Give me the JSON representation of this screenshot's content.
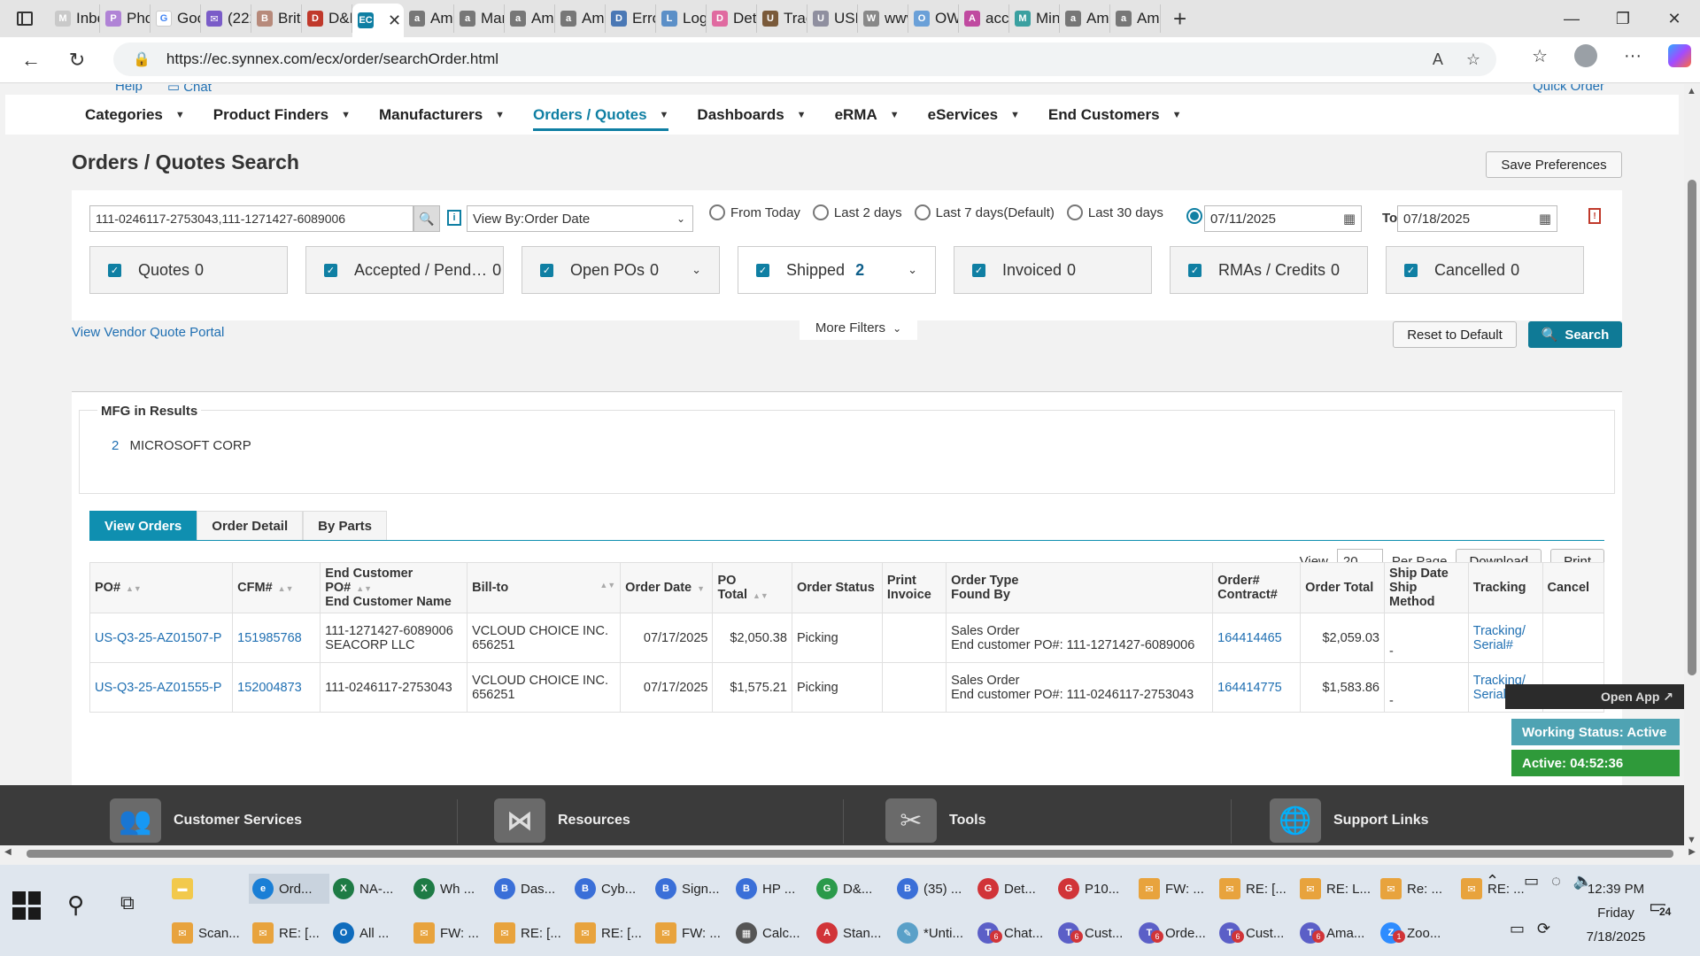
{
  "browser": {
    "tabs": [
      {
        "label": "Inbo",
        "color": "#c9c9c9",
        "glyph": "M"
      },
      {
        "label": "Phot",
        "color": "#b083d6",
        "glyph": "P"
      },
      {
        "label": "Goo",
        "color": "#ffffff",
        "glyph": "G"
      },
      {
        "label": "(222",
        "color": "#7a5cc8",
        "glyph": "✉"
      },
      {
        "label": "Briti",
        "color": "#b78a7b",
        "glyph": "B"
      },
      {
        "label": "D&H",
        "color": "#c0392b",
        "glyph": "D"
      },
      {
        "label": "",
        "color": "#0f7fa3",
        "glyph": "EC",
        "active": true
      },
      {
        "label": "Ama",
        "color": "#777777",
        "glyph": "a"
      },
      {
        "label": "Man",
        "color": "#777777",
        "glyph": "a"
      },
      {
        "label": "Ama",
        "color": "#777777",
        "glyph": "a"
      },
      {
        "label": "Ama",
        "color": "#777777",
        "glyph": "a"
      },
      {
        "label": "Erro",
        "color": "#4a78b5",
        "glyph": "D"
      },
      {
        "label": "Log",
        "color": "#5b8fc7",
        "glyph": "L"
      },
      {
        "label": "Deta",
        "color": "#e06aa0",
        "glyph": "D"
      },
      {
        "label": "Trac",
        "color": "#7a5a3a",
        "glyph": "U"
      },
      {
        "label": "USP",
        "color": "#8f8f9f",
        "glyph": "U"
      },
      {
        "label": "wwv",
        "color": "#888888",
        "glyph": "W"
      },
      {
        "label": "OW(",
        "color": "#6aa0d8",
        "glyph": "O"
      },
      {
        "label": "accc",
        "color": "#c04aa0",
        "glyph": "A"
      },
      {
        "label": "Mini",
        "color": "#3aa0a0",
        "glyph": "M"
      },
      {
        "label": "Ama",
        "color": "#777777",
        "glyph": "a"
      },
      {
        "label": "Ama",
        "color": "#777777",
        "glyph": "a"
      }
    ],
    "url": "https://ec.synnex.com/ecx/order/searchOrder.html"
  },
  "header": {
    "help": "Help",
    "chat": "Chat",
    "quick_order": "Quick Order",
    "menu": [
      {
        "label": "Categories"
      },
      {
        "label": "Product Finders"
      },
      {
        "label": "Manufacturers"
      },
      {
        "label": "Orders / Quotes",
        "active": true
      },
      {
        "label": "Dashboards"
      },
      {
        "label": "eRMA"
      },
      {
        "label": "eServices"
      },
      {
        "label": "End Customers"
      }
    ]
  },
  "page": {
    "title": "Orders / Quotes Search",
    "save_preferences": "Save Preferences"
  },
  "filters": {
    "search_value": "111-0246117-2753043,111-1271427-6089006",
    "view_by": "View By:Order Date",
    "radios": [
      "From Today",
      "Last 2 days",
      "Last 7 days(Default)",
      "Last 30 days"
    ],
    "date_from": "07/11/2025",
    "to_label": "To",
    "date_to": "07/18/2025",
    "statuses": [
      {
        "label": "Quotes",
        "count": "0"
      },
      {
        "label": "Accepted / Pend…",
        "count": "0"
      },
      {
        "label": "Open POs",
        "count": "0",
        "dropdown": true
      },
      {
        "label": "Shipped",
        "count": "2",
        "dropdown": true,
        "highlight": true
      },
      {
        "label": "Invoiced",
        "count": "0"
      },
      {
        "label": "RMAs / Credits",
        "count": "0"
      },
      {
        "label": "Cancelled",
        "count": "0"
      }
    ],
    "vendor_link": "View Vendor Quote Portal",
    "more_filters": "More Filters",
    "reset": "Reset to Default",
    "search": "Search"
  },
  "results": {
    "mfg_title": "MFG in Results",
    "mfg": [
      {
        "count": "2",
        "name": "MICROSOFT CORP"
      }
    ],
    "tabs": [
      "View Orders",
      "Order Detail",
      "By Parts"
    ],
    "pager": {
      "view": "View",
      "per_page_value": "20",
      "per_page": "Per Page",
      "download": "Download",
      "print": "Print"
    },
    "columns": {
      "po": "PO#",
      "cfm": "CFM#",
      "end_cust_1": "End Customer PO#",
      "end_cust_2": "End Customer Name",
      "bill_to": "Bill-to",
      "order_date": "Order Date",
      "po_total": "PO Total",
      "order_status": "Order Status",
      "print_1": "Print",
      "print_2": "Invoice",
      "order_type_1": "Order Type",
      "order_type_2": "Found By",
      "order_no_1": "Order#",
      "order_no_2": "Contract#",
      "order_total": "Order Total",
      "ship_1": "Ship Date",
      "ship_2": "Ship Method",
      "tracking": "Tracking",
      "cancel": "Cancel"
    },
    "rows": [
      {
        "po": "US-Q3-25-AZ01507-P",
        "cfm": "151985768",
        "end_po": "111-1271427-6089006",
        "end_name": "SEACORP LLC",
        "bill_name": "VCLOUD CHOICE INC.",
        "bill_no": "656251",
        "order_date": "07/17/2025",
        "po_total": "$2,050.38",
        "status": "Picking",
        "type": "Sales Order",
        "found_by": "End customer PO#: 111-1271427-6089006",
        "order_no": "164414465",
        "order_total": "$2,059.03",
        "ship": "-",
        "tracking_1": "Tracking/",
        "tracking_2": "Serial#"
      },
      {
        "po": "US-Q3-25-AZ01555-P",
        "cfm": "152004873",
        "end_po": "111-0246117-2753043",
        "end_name": "",
        "bill_name": "VCLOUD CHOICE INC.",
        "bill_no": "656251",
        "order_date": "07/17/2025",
        "po_total": "$1,575.21",
        "status": "Picking",
        "type": "Sales Order",
        "found_by": "End customer PO#: 111-0246117-2753043",
        "order_no": "164414775",
        "order_total": "$1,583.86",
        "ship": "-",
        "tracking_1": "Tracking/",
        "tracking_2": "Serial#"
      }
    ]
  },
  "footer": {
    "sections": [
      "Customer Services",
      "Resources",
      "Tools",
      "Support Links"
    ],
    "open_app": "Open App ↗",
    "working_status": "Working Status: Active",
    "active_timer": "Active: 04:52:36"
  },
  "taskbar": {
    "row1": [
      {
        "label": "",
        "color": "#f2c94c",
        "glyph": "▬"
      },
      {
        "label": "Ord...",
        "color": "#1a7fd6",
        "glyph": "e",
        "active": true
      },
      {
        "label": "NA-...",
        "color": "#1e7b45",
        "glyph": "X"
      },
      {
        "label": "Wh ...",
        "color": "#1e7b45",
        "glyph": "X"
      },
      {
        "label": "Das...",
        "color": "#3a6fd8",
        "glyph": "B"
      },
      {
        "label": "Cyb...",
        "color": "#3a6fd8",
        "glyph": "B"
      },
      {
        "label": "Sign...",
        "color": "#3a6fd8",
        "glyph": "B"
      },
      {
        "label": "HP ...",
        "color": "#3a6fd8",
        "glyph": "B"
      },
      {
        "label": "D&...",
        "color": "#2a9a4a",
        "glyph": "G"
      },
      {
        "label": "(35) ...",
        "color": "#3a6fd8",
        "glyph": "B"
      },
      {
        "label": "Det...",
        "color": "#d13438",
        "glyph": "G"
      },
      {
        "label": "P10...",
        "color": "#d13438",
        "glyph": "G"
      },
      {
        "label": "FW: ...",
        "color": "#e8a33d",
        "glyph": "✉"
      },
      {
        "label": "RE: [...",
        "color": "#e8a33d",
        "glyph": "✉"
      },
      {
        "label": "RE: L...",
        "color": "#e8a33d",
        "glyph": "✉"
      },
      {
        "label": "Re: ...",
        "color": "#e8a33d",
        "glyph": "✉"
      },
      {
        "label": "RE: ...",
        "color": "#e8a33d",
        "glyph": "✉"
      }
    ],
    "row2": [
      {
        "label": "Scan...",
        "color": "#e8a33d",
        "glyph": "✉"
      },
      {
        "label": "RE: [...",
        "color": "#e8a33d",
        "glyph": "✉"
      },
      {
        "label": "All ...",
        "color": "#0f6cbd",
        "glyph": "O"
      },
      {
        "label": "FW: ...",
        "color": "#e8a33d",
        "glyph": "✉"
      },
      {
        "label": "RE: [...",
        "color": "#e8a33d",
        "glyph": "✉"
      },
      {
        "label": "RE: [...",
        "color": "#e8a33d",
        "glyph": "✉"
      },
      {
        "label": "FW: ...",
        "color": "#e8a33d",
        "glyph": "✉"
      },
      {
        "label": "Calc...",
        "color": "#555555",
        "glyph": "▦"
      },
      {
        "label": "Stan...",
        "color": "#d13438",
        "glyph": "A"
      },
      {
        "label": "*Unti...",
        "color": "#5aa0c8",
        "glyph": "✎"
      },
      {
        "label": "Chat...",
        "color": "#5b5fc7",
        "glyph": "T",
        "badge": "6"
      },
      {
        "label": "Cust...",
        "color": "#5b5fc7",
        "glyph": "T",
        "badge": "6"
      },
      {
        "label": "Orde...",
        "color": "#5b5fc7",
        "glyph": "T",
        "badge": "6"
      },
      {
        "label": "Cust...",
        "color": "#5b5fc7",
        "glyph": "T",
        "badge": "6"
      },
      {
        "label": "Ama...",
        "color": "#5b5fc7",
        "glyph": "T",
        "badge": "6"
      },
      {
        "label": "Zoo...",
        "color": "#2d8cff",
        "glyph": "Z",
        "badge": "1"
      }
    ],
    "time": "12:39 PM",
    "day": "Friday",
    "date": "7/18/2025",
    "notifications": "24"
  }
}
